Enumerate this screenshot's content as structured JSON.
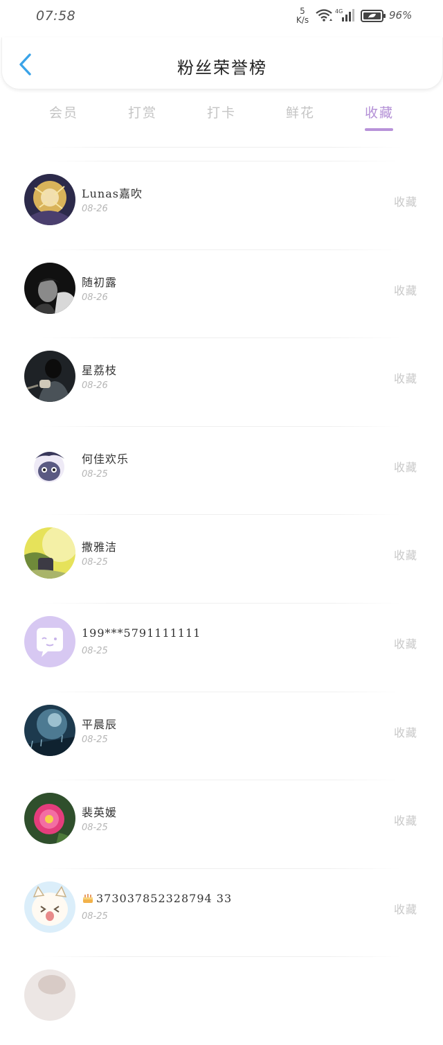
{
  "status_bar": {
    "time": "07:58",
    "net_speed_value": "5",
    "net_speed_unit": "K/s",
    "signal_label": "4G",
    "battery": "96%"
  },
  "header": {
    "title": "粉丝荣誉榜",
    "back_icon": "chevron-left-icon"
  },
  "tabs": [
    {
      "label": "会员",
      "active": false
    },
    {
      "label": "打赏",
      "active": false
    },
    {
      "label": "打卡",
      "active": false
    },
    {
      "label": "鲜花",
      "active": false
    },
    {
      "label": "收藏",
      "active": true
    }
  ],
  "colors": {
    "accent": "#b892d9",
    "back_arrow": "#3aa3e8",
    "muted_text": "#c8c8c8"
  },
  "list": [
    {
      "name": "Lunas嘉吹",
      "date": "08-26",
      "action": "收藏"
    },
    {
      "name": "随初露",
      "date": "08-26",
      "action": "收藏"
    },
    {
      "name": "星荔枝",
      "date": "08-26",
      "action": "收藏"
    },
    {
      "name": "何佳欢乐",
      "date": "08-25",
      "action": "收藏"
    },
    {
      "name": "撒雅洁",
      "date": "08-25",
      "action": "收藏"
    },
    {
      "name": "199***5791111111",
      "date": "08-25",
      "action": "收藏"
    },
    {
      "name": "平晨辰",
      "date": "08-25",
      "action": "收藏"
    },
    {
      "name": "裴英媛",
      "date": "08-25",
      "action": "收藏"
    },
    {
      "name": "373037852328794 33",
      "date": "08-25",
      "action": "收藏"
    }
  ]
}
